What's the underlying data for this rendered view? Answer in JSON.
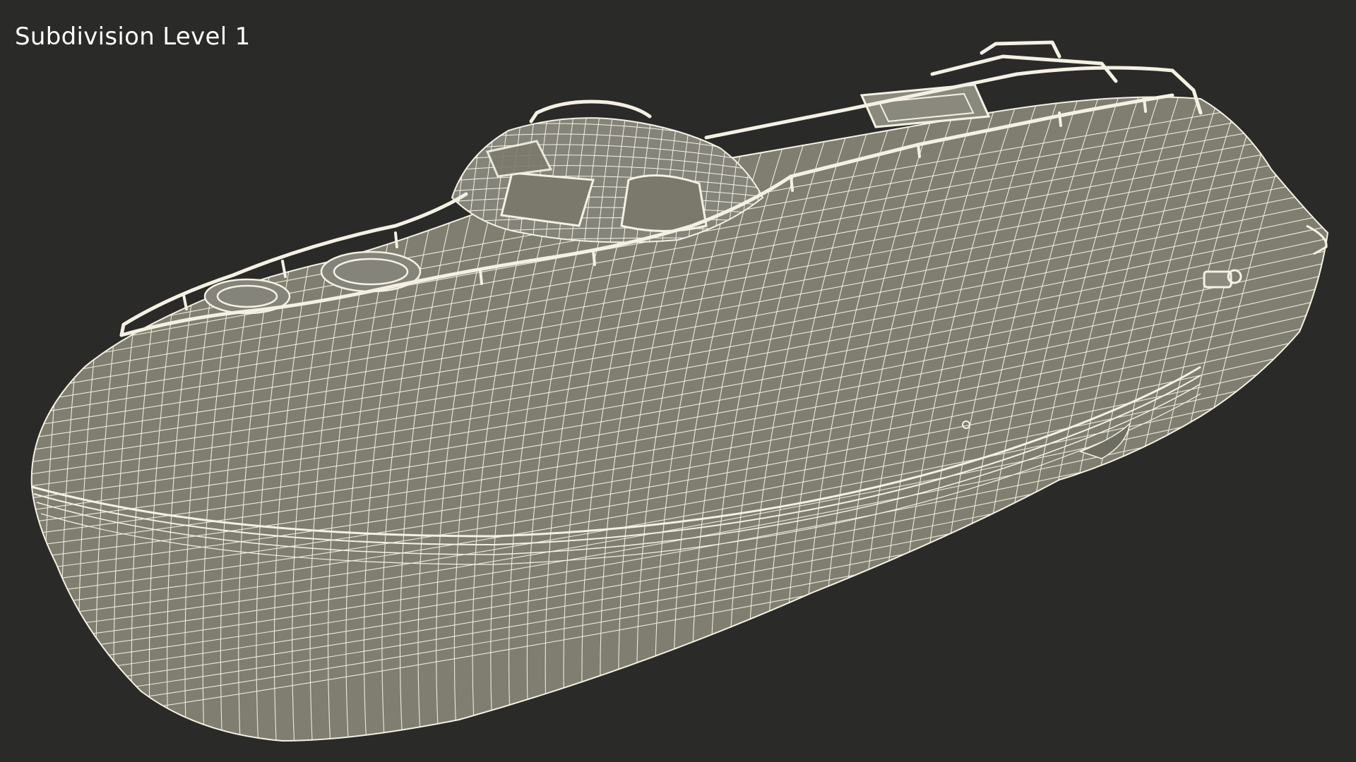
{
  "viewport": {
    "label": "Subdivision Level 1",
    "background_color": "#2a2a28",
    "surface_color": "#7f7e70",
    "wire_color": "#f4f1e4"
  }
}
